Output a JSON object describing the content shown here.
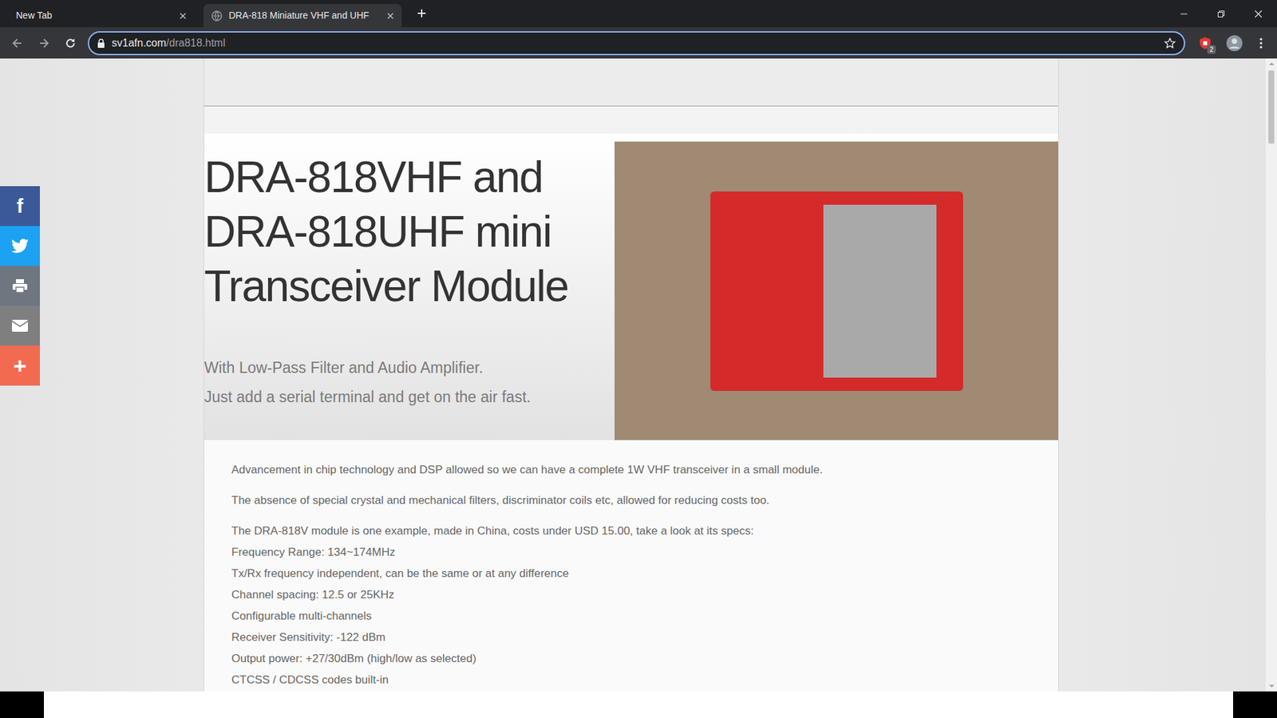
{
  "tabs": [
    {
      "label": "New Tab",
      "selected": false
    },
    {
      "label": "DRA-818 Miniature VHF and UHF",
      "selected": true
    }
  ],
  "address_bar": {
    "host": "sv1afn.com",
    "path": "/dra818.html"
  },
  "toolbar": {
    "extension_badge": "2"
  },
  "share_buttons": [
    {
      "kind": "facebook",
      "label": "f",
      "color": "#3b5998"
    },
    {
      "kind": "twitter",
      "label": "",
      "color": "#1da1f2"
    },
    {
      "kind": "print",
      "label": "",
      "color": "#6e7780"
    },
    {
      "kind": "email",
      "label": "",
      "color": "#7f7f7f"
    },
    {
      "kind": "more",
      "label": "+",
      "color": "#f26b51"
    }
  ],
  "hero": {
    "title": [
      "DRA-818VHF and",
      "DRA-818UHF mini",
      "Transceiver Module"
    ],
    "subtitle": [
      "With Low-Pass Filter and Audio Amplifier.",
      "Just add a serial terminal and get on the air fast."
    ]
  },
  "article": {
    "paragraphs": [
      "Advancement in chip technology and DSP allowed so we can have a complete 1W VHF transceiver in a small module.",
      "The absence of special crystal and mechanical filters, discriminator coils etc, allowed for reducing costs too.",
      "The DRA-818V module is one example, made in China, costs under USD 15.00, take a look at its specs:"
    ],
    "specs": [
      "Frequency Range: 134~174MHz",
      "Tx/Rx frequency independent, can be the same or at any difference",
      "Channel spacing: 12.5 or 25KHz",
      "Configurable multi-channels",
      "Receiver Sensitivity: -122 dBm",
      "Output power: +27/30dBm (high/low as selected)",
      "CTCSS / CDCSS codes built-in"
    ]
  }
}
